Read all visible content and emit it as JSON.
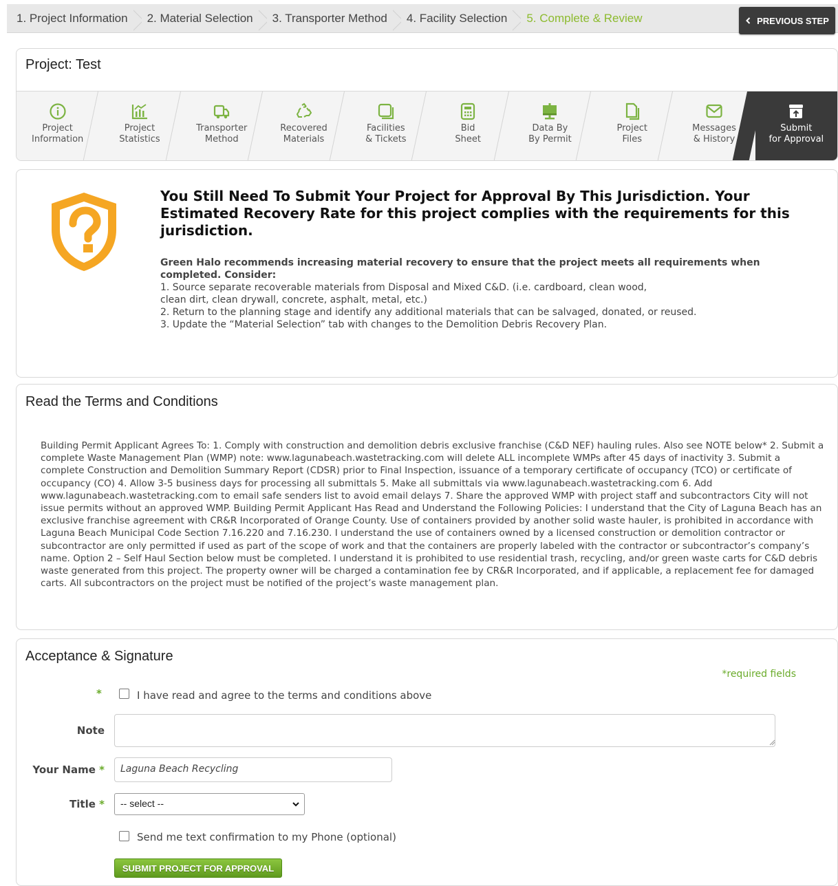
{
  "wizard": {
    "steps": [
      {
        "label": "1. Project Information"
      },
      {
        "label": "2. Material Selection"
      },
      {
        "label": "3. Transporter Method"
      },
      {
        "label": "4. Facility Selection"
      },
      {
        "label": "5. Complete & Review"
      }
    ],
    "active_step": 4,
    "prev_button": "PREVIOUS STEP",
    "prev_icon": "chevron-left-icon"
  },
  "project": {
    "title": "Project:  Test",
    "nav": [
      {
        "line1": "Project",
        "line2": "Information",
        "icon": "info-icon"
      },
      {
        "line1": "Project",
        "line2": "Statistics",
        "icon": "chart-icon"
      },
      {
        "line1": "Transporter",
        "line2": "Method",
        "icon": "truck-icon"
      },
      {
        "line1": "Recovered",
        "line2": "Materials",
        "icon": "recycle-icon"
      },
      {
        "line1": "Facilities",
        "line2": "& Tickets",
        "icon": "facility-icon"
      },
      {
        "line1": "Bid",
        "line2": "Sheet",
        "icon": "calculator-icon"
      },
      {
        "line1": "Data By",
        "line2": "By Permit",
        "icon": "presentation-icon"
      },
      {
        "line1": "Project",
        "line2": "Files",
        "icon": "files-icon"
      },
      {
        "line1": "Messages",
        "line2": "& History",
        "icon": "envelope-icon"
      },
      {
        "line1": "Submit",
        "line2": "for Approval",
        "icon": "upload-box-icon"
      }
    ]
  },
  "warning": {
    "icon": "shield-question-icon",
    "title": "You Still Need To Submit Your Project for Approval By This Jurisdiction. Your Estimated Recovery Rate for this project complies with the requirements for this jurisdiction.",
    "lead": "Green Halo recommends increasing material recovery to ensure that the project meets all requirements when completed. Consider:",
    "items": [
      "1. Source separate recoverable materials from Disposal and Mixed C&D. (i.e. cardboard, clean wood,",
      "clean dirt, clean drywall, concrete, asphalt, metal, etc.)",
      "2. Return to the planning stage and identify any additional materials that can be salvaged, donated, or reused.",
      "3. Update the “Material Selection” tab with changes to the Demolition Debris Recovery Plan."
    ]
  },
  "terms": {
    "heading": "Read the Terms and Conditions",
    "text": "Building Permit Applicant Agrees To: 1. Comply with construction and demolition debris exclusive franchise (C&D NEF) hauling rules. Also see NOTE below* 2. Submit a complete Waste Management Plan (WMP) note: www.lagunabeach.wastetracking.com will delete ALL incomplete WMPs after 45 days of inactivity 3. Submit a complete Construction and Demolition Summary Report (CDSR) prior to Final Inspection, issuance of a temporary certificate of occupancy (TCO) or certificate of occupancy (CO) 4. Allow 3-5 business days for processing all submittals 5. Make all submittals via www.lagunabeach.wastetracking.com 6. Add www.lagunabeach.wastetracking.com to email safe senders list to avoid email delays 7. Share the approved WMP with project staff and subcontractors City will not issue permits without an approved WMP. Building Permit Applicant Has Read and Understand the Following Policies: I understand that the City of Laguna Beach has an exclusive franchise agreement with CR&R Incorporated of Orange County. Use of containers provided by another solid waste hauler, is prohibited in accordance with Laguna Beach Municipal Code Section 7.16.220 and 7.16.230. I understand the use of containers owned by a licensed construction or demolition contractor or subcontractor are only permitted if used as part of the scope of work and that the containers are properly labeled with the contractor or subcontractor’s company’s name. Option 2 – Self Haul Section below must be completed. I understand it is prohibited to use residential trash, recycling, and/or green waste carts for C&D debris waste generated from this project. The property owner will be charged a contamination fee by CR&R Incorporated, and if applicable, a replacement fee for damaged carts. All subcontractors on the project must be notified of the project’s waste management plan."
  },
  "acceptance": {
    "heading": "Acceptance & Signature",
    "required_note": "*required fields",
    "agree_label": "I have read and agree to the terms and conditions above",
    "agree_checked": false,
    "note_label": "Note",
    "note_value": "",
    "name_label": "Your Name",
    "name_value": "Laguna Beach Recycling",
    "title_label": "Title",
    "title_selected": "-- select --",
    "sms_label": "Send me text confirmation to my Phone (optional)",
    "sms_checked": false,
    "required_star": "*",
    "submit_label": "SUBMIT PROJECT FOR APPROVAL"
  },
  "colors": {
    "accent_green": "#8dbb2f",
    "shield_orange": "#f5a623",
    "dark_button": "#3b3b3b"
  }
}
